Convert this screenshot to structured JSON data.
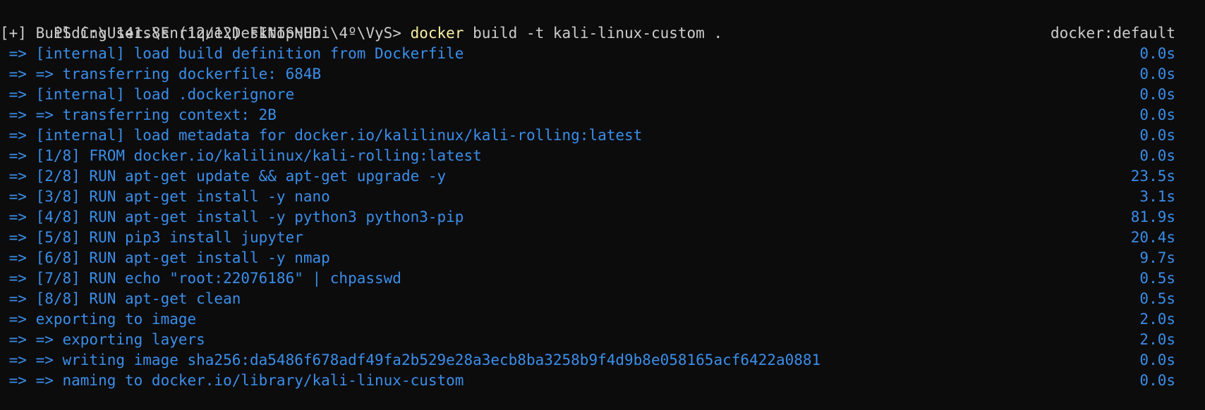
{
  "prompt": {
    "path": "PS C:\\Users\\Enrique\\Desktop\\Uni\\4º\\VyS> ",
    "command": "docker",
    "args": " build -t kali-linux-custom ."
  },
  "header": {
    "status": "[+] Building 141.8s (12/12) FINISHED",
    "context": "docker:default"
  },
  "steps": [
    {
      "text": " => [internal] load build definition from Dockerfile",
      "time": "0.0s"
    },
    {
      "text": " => => transferring dockerfile: 684B",
      "time": "0.0s"
    },
    {
      "text": " => [internal] load .dockerignore",
      "time": "0.0s"
    },
    {
      "text": " => => transferring context: 2B",
      "time": "0.0s"
    },
    {
      "text": " => [internal] load metadata for docker.io/kalilinux/kali-rolling:latest",
      "time": "0.0s"
    },
    {
      "text": " => [1/8] FROM docker.io/kalilinux/kali-rolling:latest",
      "time": "0.0s"
    },
    {
      "text": " => [2/8] RUN apt-get update && apt-get upgrade -y",
      "time": "23.5s"
    },
    {
      "text": " => [3/8] RUN apt-get install -y nano",
      "time": "3.1s"
    },
    {
      "text": " => [4/8] RUN apt-get install -y python3 python3-pip",
      "time": "81.9s"
    },
    {
      "text": " => [5/8] RUN pip3 install jupyter",
      "time": "20.4s"
    },
    {
      "text": " => [6/8] RUN apt-get install -y nmap",
      "time": "9.7s"
    },
    {
      "text": " => [7/8] RUN echo \"root:22076186\" | chpasswd",
      "time": "0.5s"
    },
    {
      "text": " => [8/8] RUN apt-get clean",
      "time": "0.5s"
    },
    {
      "text": " => exporting to image",
      "time": "2.0s"
    },
    {
      "text": " => => exporting layers",
      "time": "2.0s"
    },
    {
      "text": " => => writing image sha256:da5486f678adf49fa2b529e28a3ecb8ba3258b9f4d9b8e058165acf6422a0881",
      "time": "0.0s"
    },
    {
      "text": " => => naming to docker.io/library/kali-linux-custom",
      "time": "0.0s"
    }
  ],
  "colors": {
    "background": "#0c0c0c",
    "text": "#cccccc",
    "command": "#f9f1a5",
    "step": "#3b8eea"
  }
}
